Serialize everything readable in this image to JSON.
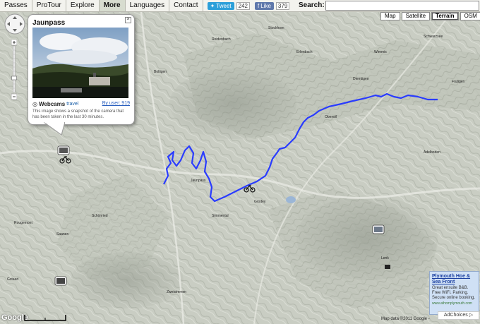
{
  "nav": {
    "items": [
      {
        "label": "Passes"
      },
      {
        "label": "ProTour"
      },
      {
        "label": "Explore"
      },
      {
        "label": "More"
      },
      {
        "label": "Languages"
      },
      {
        "label": "Contact"
      }
    ],
    "active": "More"
  },
  "social": {
    "tweet_label": "Tweet",
    "tweet_count": "242",
    "like_label": "Like",
    "like_count": "379"
  },
  "search": {
    "label": "Search:",
    "value": ""
  },
  "map_types": [
    {
      "label": "Map"
    },
    {
      "label": "Satellite"
    },
    {
      "label": "Terrain"
    },
    {
      "label": "OSM"
    }
  ],
  "map_type_active": "Terrain",
  "infowindow": {
    "title": "Jaunpass",
    "logo_text": "Webcams",
    "logo_sub": "travel",
    "by_user": "By user: 919",
    "description": "This image shows a snapshot of the camera that has been taken in the last 30 minutes."
  },
  "ad": {
    "title": "Plymouth Hoe & Sea Front",
    "text": "Great ensuite B&B. Free WiFi. Parking. Secure online booking.",
    "link": "www.athomplymouth.com",
    "choices": "AdChoices ▷"
  },
  "map_labels": [
    "Boltigen",
    "Jaunpass",
    "Zweisimmen",
    "Gstaad",
    "Lenk",
    "Adelboden",
    "Frutigen",
    "Erlenbach",
    "Oberwil",
    "Diemtigen",
    "Grodey",
    "Saanen",
    "Rougemont",
    "Schönried",
    "Simmental",
    "Reidenbach",
    "Schwarzsee",
    "Stockhorn",
    "Wimmis"
  ],
  "copyright": "Map data ©2011 Google -",
  "colors": {
    "route": "#2a3cff",
    "nav_bg": "#f3f3ee",
    "ad_bg": "#cfe0f5"
  },
  "icons": [
    "pan-control-icon",
    "zoom-in-icon",
    "zoom-out-icon",
    "camera-icon",
    "bicycle-icon",
    "close-icon"
  ]
}
